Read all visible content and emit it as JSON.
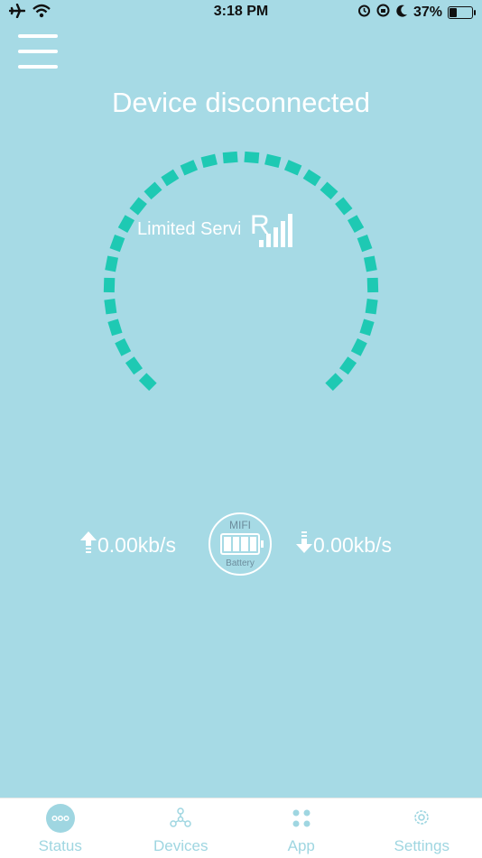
{
  "status_bar": {
    "time": "3:18 PM",
    "battery": "37%",
    "battery_level": 0.37
  },
  "title": "Device disconnected",
  "signal": {
    "service": "Limited Service",
    "roaming": "R"
  },
  "rates": {
    "upload": "0.00kb/s",
    "download": "0.00kb/s"
  },
  "mifi": {
    "label": "MIFI",
    "sublabel": "Battery",
    "bars": 4
  },
  "tabs": [
    {
      "label": "Status",
      "icon": "status-icon"
    },
    {
      "label": "Devices",
      "icon": "devices-icon"
    },
    {
      "label": "App",
      "icon": "app-icon"
    },
    {
      "label": "Settings",
      "icon": "settings-icon"
    }
  ],
  "colors": {
    "background": "#a6dae5",
    "gauge": "#1ec9b3",
    "tab_active": "#9fd6e1"
  }
}
